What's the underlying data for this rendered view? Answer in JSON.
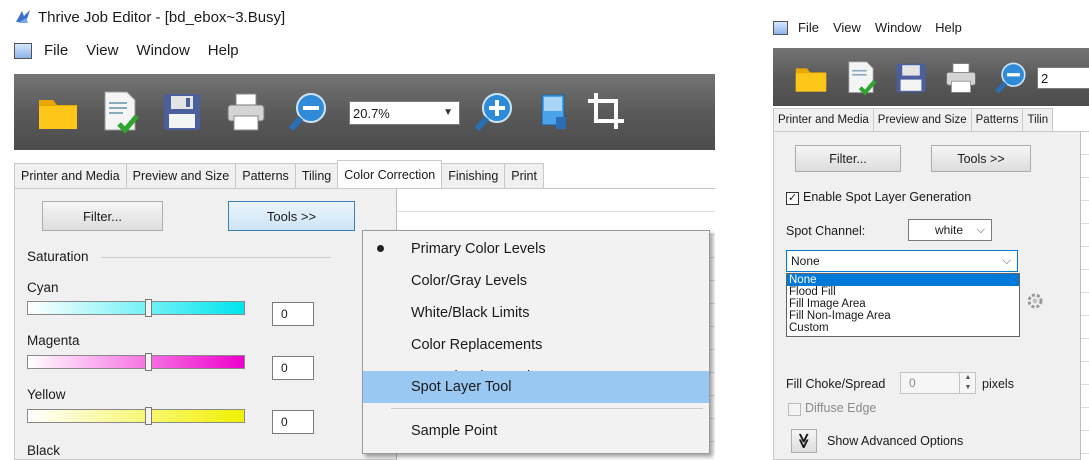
{
  "left": {
    "window_title": "Thrive Job Editor - [bd_ebox~3.Busy]",
    "menu": [
      "File",
      "View",
      "Window",
      "Help"
    ],
    "zoom": "20.7%",
    "tabs": [
      "Printer and Media",
      "Preview and Size",
      "Patterns",
      "Tiling",
      "Color Correction",
      "Finishing",
      "Print"
    ],
    "active_tab": "Color Correction",
    "filter_button": "Filter...",
    "tools_button": "Tools >>",
    "group_label": "Saturation",
    "channels": [
      {
        "label": "Cyan",
        "value": "0",
        "color": "#00e5ee"
      },
      {
        "label": "Magenta",
        "value": "0",
        "color": "#ee00cc"
      },
      {
        "label": "Yellow",
        "value": "0",
        "color": "#f0f000"
      },
      {
        "label": "Black",
        "value": "",
        "color": "#000000"
      }
    ],
    "tools_menu": [
      {
        "label": "Primary Color Levels",
        "checked": true
      },
      {
        "label": "Color/Gray Levels"
      },
      {
        "label": "White/Black Limits"
      },
      {
        "label": "Color Replacements"
      },
      {
        "label": "Named Color Replacements"
      },
      {
        "label": "Spot Layer Tool",
        "highlighted": true
      },
      {
        "label": "Sample Point"
      }
    ]
  },
  "right": {
    "menu": [
      "File",
      "View",
      "Window",
      "Help"
    ],
    "zoom_partial": "2",
    "tabs": [
      "Printer and Media",
      "Preview and Size",
      "Patterns",
      "Tilin"
    ],
    "filter_button": "Filter...",
    "tools_button": "Tools >>",
    "enable_spot_label": "Enable Spot Layer Generation",
    "enable_spot_checked": true,
    "spot_channel_label": "Spot Channel:",
    "spot_channel_value": "white",
    "fill_type_value": "None",
    "fill_type_options": [
      "None",
      "Flood Fill",
      "Fill Image Area",
      "Fill Non-Image Area",
      "Custom"
    ],
    "choke_label": "Fill Choke/Spread",
    "choke_value": "0",
    "choke_units": "pixels",
    "diffuse_label": "Diffuse Edge",
    "advanced_label": "Show Advanced Options"
  },
  "colors": {
    "toolbar_bg": "#5a5a5a",
    "menu_highlight": "#99c9f2",
    "list_selection": "#0078d7",
    "button_hot_border": "#3c7fb1"
  }
}
